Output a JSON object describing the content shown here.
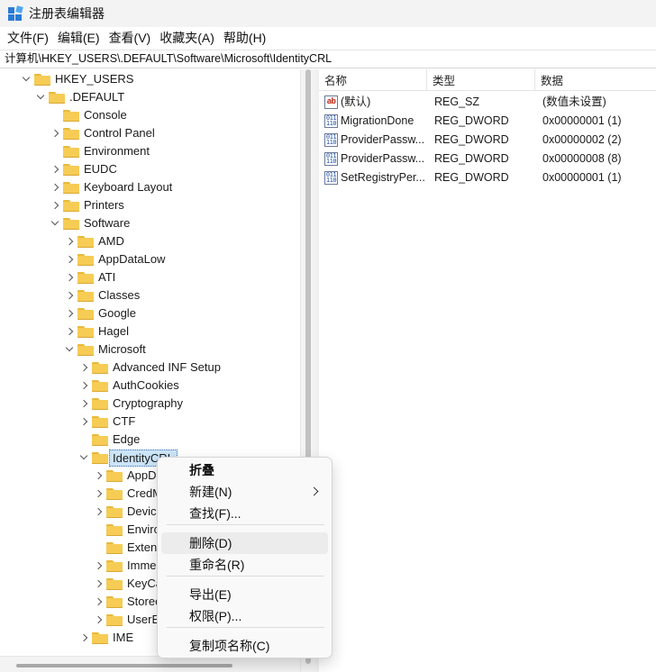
{
  "window": {
    "title": "注册表编辑器"
  },
  "menubar": [
    "文件(F)",
    "编辑(E)",
    "查看(V)",
    "收藏夹(A)",
    "帮助(H)"
  ],
  "address": "计算机\\HKEY_USERS\\.DEFAULT\\Software\\Microsoft\\IdentityCRL",
  "tree": [
    {
      "label": "HKEY_USERS",
      "level": 0,
      "expander": "down"
    },
    {
      "label": ".DEFAULT",
      "level": 1,
      "expander": "down"
    },
    {
      "label": "Console",
      "level": 2,
      "expander": "none"
    },
    {
      "label": "Control Panel",
      "level": 2,
      "expander": "right"
    },
    {
      "label": "Environment",
      "level": 2,
      "expander": "none"
    },
    {
      "label": "EUDC",
      "level": 2,
      "expander": "right"
    },
    {
      "label": "Keyboard Layout",
      "level": 2,
      "expander": "right"
    },
    {
      "label": "Printers",
      "level": 2,
      "expander": "right"
    },
    {
      "label": "Software",
      "level": 2,
      "expander": "down"
    },
    {
      "label": "AMD",
      "level": 3,
      "expander": "right"
    },
    {
      "label": "AppDataLow",
      "level": 3,
      "expander": "right"
    },
    {
      "label": "ATI",
      "level": 3,
      "expander": "right"
    },
    {
      "label": "Classes",
      "level": 3,
      "expander": "right"
    },
    {
      "label": "Google",
      "level": 3,
      "expander": "right"
    },
    {
      "label": "Hagel",
      "level": 3,
      "expander": "right"
    },
    {
      "label": "Microsoft",
      "level": 3,
      "expander": "down"
    },
    {
      "label": "Advanced INF Setup",
      "level": 4,
      "expander": "right"
    },
    {
      "label": "AuthCookies",
      "level": 4,
      "expander": "right"
    },
    {
      "label": "Cryptography",
      "level": 4,
      "expander": "right"
    },
    {
      "label": "CTF",
      "level": 4,
      "expander": "right"
    },
    {
      "label": "Edge",
      "level": 4,
      "expander": "none"
    },
    {
      "label": "IdentityCRL",
      "level": 4,
      "expander": "down",
      "selected": true
    },
    {
      "label": "AppD",
      "level": 5,
      "expander": "right"
    },
    {
      "label": "CredM",
      "level": 5,
      "expander": "right"
    },
    {
      "label": "Device",
      "level": 5,
      "expander": "right"
    },
    {
      "label": "Enviro",
      "level": 5,
      "expander": "none"
    },
    {
      "label": "Extenc",
      "level": 5,
      "expander": "none"
    },
    {
      "label": "Imme",
      "level": 5,
      "expander": "right"
    },
    {
      "label": "KeyCa",
      "level": 5,
      "expander": "right"
    },
    {
      "label": "Storec",
      "level": 5,
      "expander": "right"
    },
    {
      "label": "UserE",
      "level": 5,
      "expander": "right"
    },
    {
      "label": "IME",
      "level": 4,
      "expander": "right"
    }
  ],
  "list": {
    "columns": [
      "名称",
      "类型",
      "数据"
    ],
    "rows": [
      {
        "name": "(默认)",
        "type": "REG_SZ",
        "data": "(数值未设置)",
        "icon": "string-value-icon"
      },
      {
        "name": "MigrationDone",
        "type": "REG_DWORD",
        "data": "0x00000001 (1)",
        "icon": "binary-value-icon"
      },
      {
        "name": "ProviderPassw...",
        "type": "REG_DWORD",
        "data": "0x00000002 (2)",
        "icon": "binary-value-icon"
      },
      {
        "name": "ProviderPassw...",
        "type": "REG_DWORD",
        "data": "0x00000008 (8)",
        "icon": "binary-value-icon"
      },
      {
        "name": "SetRegistryPer...",
        "type": "REG_DWORD",
        "data": "0x00000001 (1)",
        "icon": "binary-value-icon"
      }
    ]
  },
  "context_menu": {
    "items": [
      {
        "label": "折叠",
        "bold": true
      },
      {
        "label": "新建(N)",
        "submenu": true
      },
      {
        "label": "查找(F)..."
      },
      {
        "label": "删除(D)",
        "hover": true
      },
      {
        "label": "重命名(R)"
      },
      {
        "label": "导出(E)"
      },
      {
        "label": "权限(P)..."
      },
      {
        "label": "复制项名称(C)"
      }
    ]
  },
  "colors": {
    "selection": "#cce4f7",
    "folder": "#f6cc55",
    "accent": "#2a7bd5"
  }
}
